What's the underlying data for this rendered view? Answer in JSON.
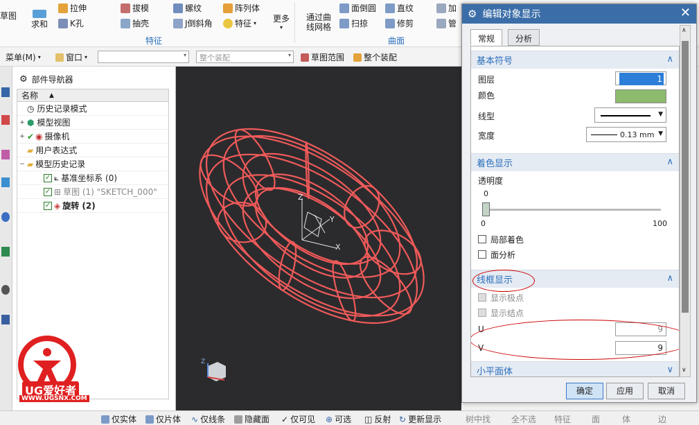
{
  "ribbon": {
    "items": {
      "extrude": "拉伸",
      "draft": "拔模",
      "thread": "螺纹",
      "pattern": "阵列体",
      "more": "更多",
      "through_curve_mesh": "通过曲线网格",
      "face_blend": "面倒圆",
      "straight_edge": "直纹",
      "add": "加",
      "pipe": "管",
      "hole": "K孔",
      "shell": "抽壳",
      "chamfer": "J倒斜角",
      "feature": "特征",
      "sweep": "扫掠",
      "trim": "修剪",
      "region": "求和",
      "sketch": "草图"
    },
    "groups": {
      "feature": "特征",
      "surface": "曲面"
    }
  },
  "toolbar2": {
    "menu": "菜单(M)",
    "window": "窗口",
    "assembly_placeholder": "整个装配",
    "sketch_range": "草图范围",
    "whole_assembly": "整个装配"
  },
  "navigator": {
    "title": "部件导航器",
    "column_name": "名称",
    "rows": [
      {
        "label": "历史记录模式"
      },
      {
        "label": "模型视图"
      },
      {
        "label": "摄像机"
      },
      {
        "label": "用户表达式"
      },
      {
        "label": "模型历史记录"
      },
      {
        "label": "基准坐标系 (0)"
      },
      {
        "label": "草图 (1) \"SKETCH_000\""
      },
      {
        "label": "旋转 (2)"
      }
    ]
  },
  "viewport": {
    "axis_labels": {
      "x": "X",
      "y": "Y",
      "z": "Z"
    }
  },
  "watermark": {
    "brand": "UG爱好者",
    "url": "WWW.UGSNX.COM"
  },
  "bottombar": {
    "items": [
      "仅实体",
      "仅片体",
      "仅线条",
      "隐藏面",
      "仅可见",
      "可选",
      "反射",
      "更新显示",
      "树中找",
      "全不选",
      "特征",
      "面",
      "体",
      "边"
    ]
  },
  "dialog": {
    "title": "编辑对象显示",
    "tabs": [
      "常规",
      "分析"
    ],
    "sections": {
      "basic": "基本符号",
      "shading": "着色显示",
      "wireframe": "线框显示",
      "facets": "小平面体"
    },
    "labels": {
      "layer": "图层",
      "color": "颜色",
      "linetype": "线型",
      "width": "宽度",
      "transparency": "透明度",
      "local_shading": "局部着色",
      "face_analysis": "面分析",
      "show_poles": "显示极点",
      "show_knots": "显示结点",
      "u": "U",
      "v": "V"
    },
    "values": {
      "layer": "1",
      "width": "0.13 mm",
      "transparency_min": "0",
      "transparency_max": "100",
      "transparency_top": "0",
      "transparency_level": 0,
      "u": "9",
      "v": "9"
    },
    "colors": {
      "object_color": "#8dbb6d",
      "wire_color": "#f05a5a"
    },
    "buttons": {
      "ok": "确定",
      "apply": "应用",
      "cancel": "取消"
    }
  }
}
